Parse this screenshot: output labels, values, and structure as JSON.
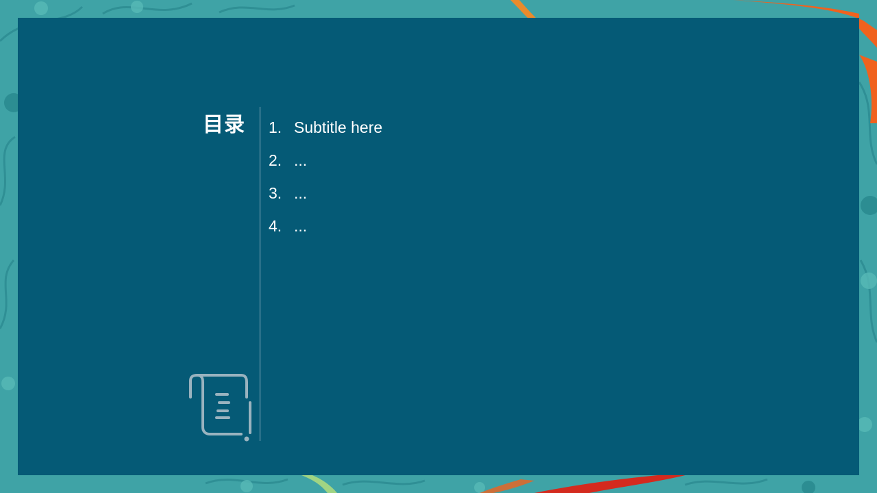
{
  "slide": {
    "title": "目录",
    "items": [
      {
        "number": "1.",
        "label": "Subtitle here"
      },
      {
        "number": "2.",
        "label": "..."
      },
      {
        "number": "3.",
        "label": "..."
      },
      {
        "number": "4.",
        "label": "..."
      }
    ],
    "icon": "scroll-icon"
  },
  "colors": {
    "background": "#3fa3a6",
    "panel": "#055a76",
    "text": "#ffffff",
    "divider": "#8fb0bf",
    "accent_orange": "#f0621e",
    "accent_red": "#d42a1e"
  }
}
